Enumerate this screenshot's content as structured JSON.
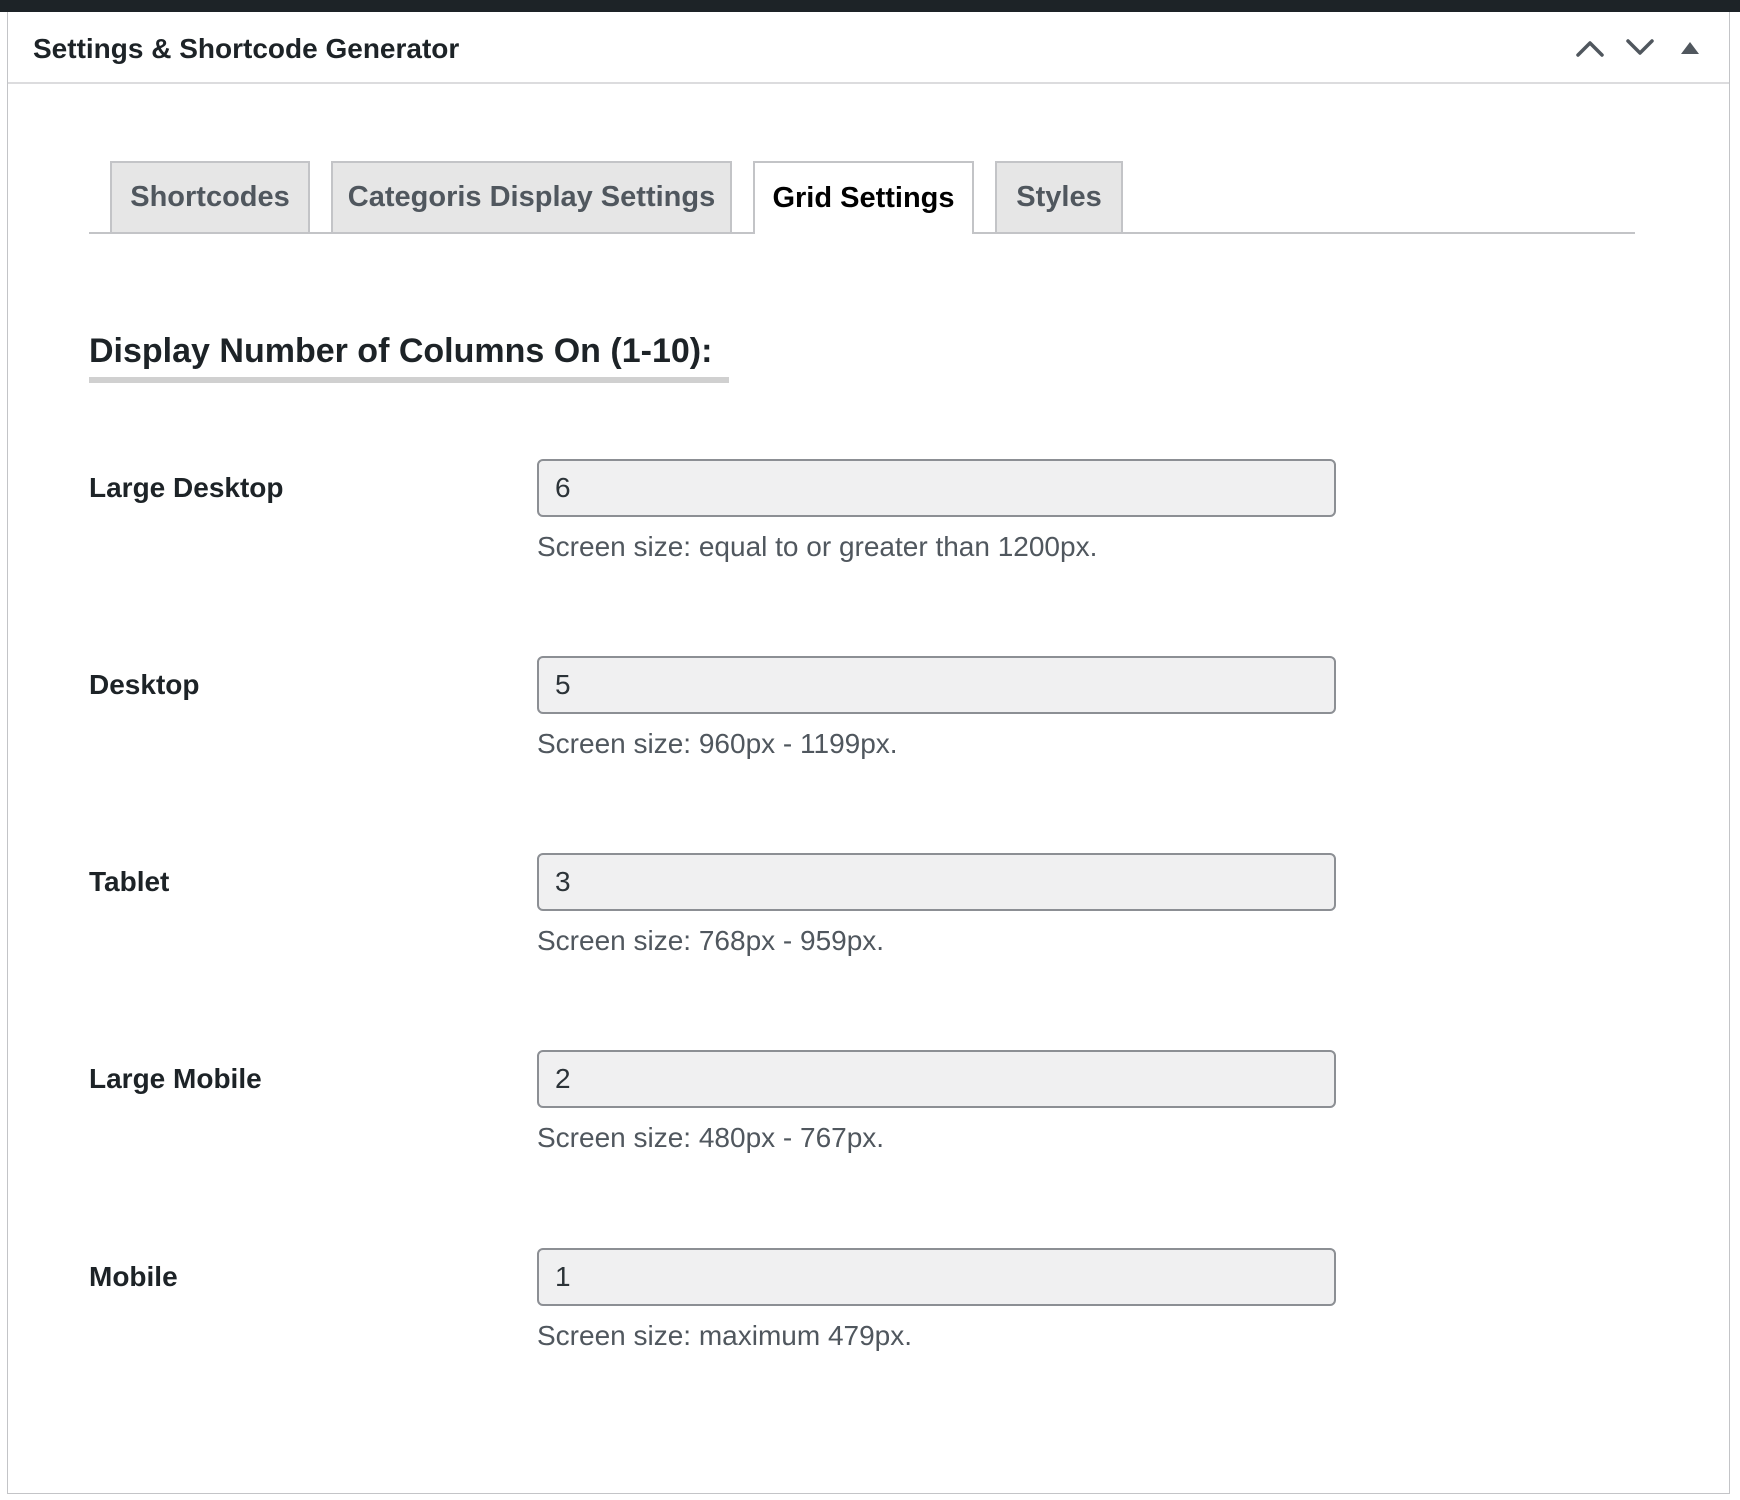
{
  "panel": {
    "title": "Settings & Shortcode Generator",
    "actions": [
      {
        "icon": "chevron-up-icon",
        "label": "Move up"
      },
      {
        "icon": "chevron-down-icon",
        "label": "Move down"
      },
      {
        "icon": "triangle-up-icon",
        "label": "Toggle panel"
      }
    ]
  },
  "tabs": [
    {
      "label": "Shortcodes",
      "active": false
    },
    {
      "label": "Categoris Display Settings",
      "active": false
    },
    {
      "label": "Grid Settings",
      "active": true
    },
    {
      "label": "Styles",
      "active": false
    }
  ],
  "section": {
    "heading": "Display Number of Columns On (1-10):"
  },
  "rows": [
    {
      "label": "Large Desktop",
      "value": "6",
      "hint": "Screen size: equal to or greater than 1200px."
    },
    {
      "label": "Desktop",
      "value": "5",
      "hint": "Screen size: 960px - 1199px."
    },
    {
      "label": "Tablet",
      "value": "3",
      "hint": "Screen size: 768px - 959px."
    },
    {
      "label": "Large Mobile",
      "value": "2",
      "hint": "Screen size: 480px - 767px."
    },
    {
      "label": "Mobile",
      "value": "1",
      "hint": "Screen size: maximum 479px."
    }
  ],
  "colors": {
    "topbar": "#1d2327",
    "tab_inactive_bg": "#e6e6e6",
    "input_bg": "#f0f0f1",
    "input_border": "#8c8f94",
    "hint_text": "#50575e"
  }
}
